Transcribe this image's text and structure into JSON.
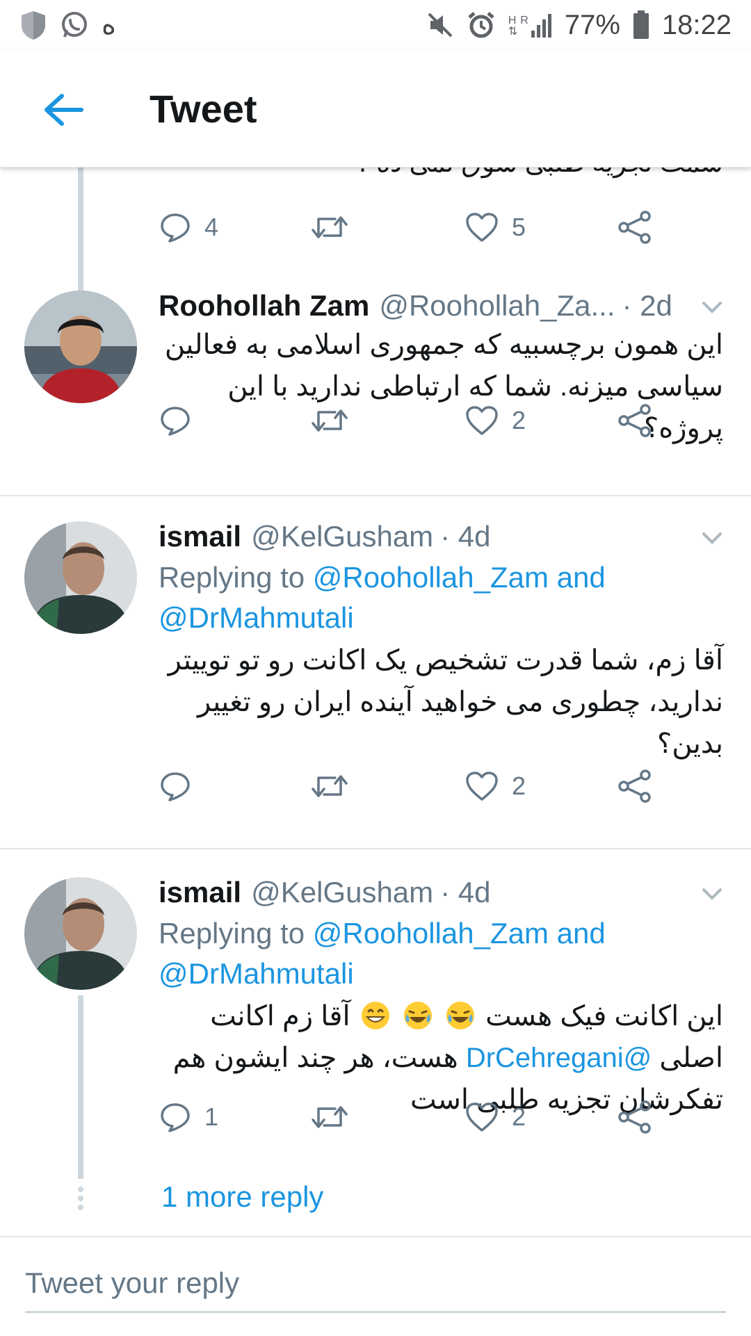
{
  "status_bar": {
    "left_glyph": "ه",
    "network_h": "H",
    "network_r": "R",
    "battery": "77%",
    "time": "18:22",
    "icons": [
      "shield-icon",
      "whatsapp-icon",
      "mute-icon",
      "alarm-icon",
      "signal-icon",
      "battery-icon"
    ]
  },
  "header": {
    "title": "Tweet"
  },
  "top_partial": {
    "cut_text": "سمت تجزیه طلبی سوق نمی ده ؟",
    "reply_count": "4",
    "like_count": "5"
  },
  "tweets": [
    {
      "name": "Roohollah Zam",
      "handle": "@Roohollah_Za...",
      "time": "· 2d",
      "body": "این همون برچسبیه که جمهوری اسلامی به فعالین سیاسی میزنه. شما که ارتباطی ندارید با این پروژه؟",
      "reply_count": "",
      "like_count": "2"
    },
    {
      "name": "ismail",
      "handle": "@KelGusham",
      "time": "· 4d",
      "replying_prefix": "Replying to",
      "replying_link1": "@Roohollah_Zam",
      "replying_and": "and",
      "replying_link2": "@DrMahmutali",
      "body": "آقا زم، شما قدرت تشخیص یک اکانت رو تو توییتر ندارید، چطوری می خواهید آینده ایران رو تغییر بدین؟",
      "reply_count": "",
      "like_count": "2"
    },
    {
      "name": "ismail",
      "handle": "@KelGusham",
      "time": "· 4d",
      "replying_prefix": "Replying to",
      "replying_link1": "@Roohollah_Zam",
      "replying_and": "and",
      "replying_link2": "@DrMahmutali",
      "body_part1": "این اکانت فیک هست",
      "body_part2": "آقا زم",
      "body_mention": "@DrCehregani",
      "body_part3": "اکانت اصلی",
      "body_part4": "هست، هر چند ایشون هم تفکرشان تجزیه طلبی است",
      "reply_count": "1",
      "like_count": "2"
    }
  ],
  "more_reply": "1 more reply",
  "reply_box": {
    "placeholder": "Tweet your reply"
  },
  "colors": {
    "accent": "#1b95e0",
    "muted": "#657786",
    "divider": "#e1e8ed",
    "thread": "#ccd6dd"
  }
}
